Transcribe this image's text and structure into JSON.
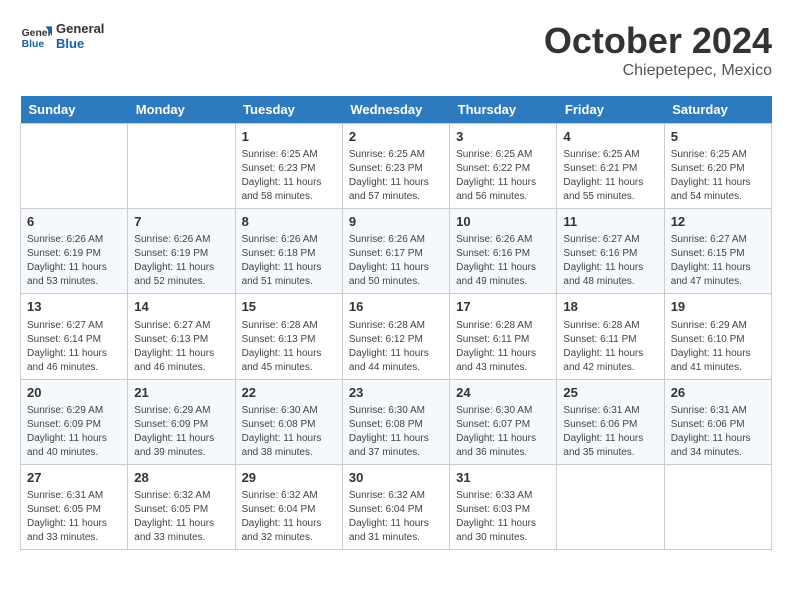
{
  "header": {
    "logo_general": "General",
    "logo_blue": "Blue",
    "month": "October 2024",
    "location": "Chiepetepec, Mexico"
  },
  "days_of_week": [
    "Sunday",
    "Monday",
    "Tuesday",
    "Wednesday",
    "Thursday",
    "Friday",
    "Saturday"
  ],
  "weeks": [
    [
      {
        "day": "",
        "info": ""
      },
      {
        "day": "",
        "info": ""
      },
      {
        "day": "1",
        "info": "Sunrise: 6:25 AM\nSunset: 6:23 PM\nDaylight: 11 hours and 58 minutes."
      },
      {
        "day": "2",
        "info": "Sunrise: 6:25 AM\nSunset: 6:23 PM\nDaylight: 11 hours and 57 minutes."
      },
      {
        "day": "3",
        "info": "Sunrise: 6:25 AM\nSunset: 6:22 PM\nDaylight: 11 hours and 56 minutes."
      },
      {
        "day": "4",
        "info": "Sunrise: 6:25 AM\nSunset: 6:21 PM\nDaylight: 11 hours and 55 minutes."
      },
      {
        "day": "5",
        "info": "Sunrise: 6:25 AM\nSunset: 6:20 PM\nDaylight: 11 hours and 54 minutes."
      }
    ],
    [
      {
        "day": "6",
        "info": "Sunrise: 6:26 AM\nSunset: 6:19 PM\nDaylight: 11 hours and 53 minutes."
      },
      {
        "day": "7",
        "info": "Sunrise: 6:26 AM\nSunset: 6:19 PM\nDaylight: 11 hours and 52 minutes."
      },
      {
        "day": "8",
        "info": "Sunrise: 6:26 AM\nSunset: 6:18 PM\nDaylight: 11 hours and 51 minutes."
      },
      {
        "day": "9",
        "info": "Sunrise: 6:26 AM\nSunset: 6:17 PM\nDaylight: 11 hours and 50 minutes."
      },
      {
        "day": "10",
        "info": "Sunrise: 6:26 AM\nSunset: 6:16 PM\nDaylight: 11 hours and 49 minutes."
      },
      {
        "day": "11",
        "info": "Sunrise: 6:27 AM\nSunset: 6:16 PM\nDaylight: 11 hours and 48 minutes."
      },
      {
        "day": "12",
        "info": "Sunrise: 6:27 AM\nSunset: 6:15 PM\nDaylight: 11 hours and 47 minutes."
      }
    ],
    [
      {
        "day": "13",
        "info": "Sunrise: 6:27 AM\nSunset: 6:14 PM\nDaylight: 11 hours and 46 minutes."
      },
      {
        "day": "14",
        "info": "Sunrise: 6:27 AM\nSunset: 6:13 PM\nDaylight: 11 hours and 46 minutes."
      },
      {
        "day": "15",
        "info": "Sunrise: 6:28 AM\nSunset: 6:13 PM\nDaylight: 11 hours and 45 minutes."
      },
      {
        "day": "16",
        "info": "Sunrise: 6:28 AM\nSunset: 6:12 PM\nDaylight: 11 hours and 44 minutes."
      },
      {
        "day": "17",
        "info": "Sunrise: 6:28 AM\nSunset: 6:11 PM\nDaylight: 11 hours and 43 minutes."
      },
      {
        "day": "18",
        "info": "Sunrise: 6:28 AM\nSunset: 6:11 PM\nDaylight: 11 hours and 42 minutes."
      },
      {
        "day": "19",
        "info": "Sunrise: 6:29 AM\nSunset: 6:10 PM\nDaylight: 11 hours and 41 minutes."
      }
    ],
    [
      {
        "day": "20",
        "info": "Sunrise: 6:29 AM\nSunset: 6:09 PM\nDaylight: 11 hours and 40 minutes."
      },
      {
        "day": "21",
        "info": "Sunrise: 6:29 AM\nSunset: 6:09 PM\nDaylight: 11 hours and 39 minutes."
      },
      {
        "day": "22",
        "info": "Sunrise: 6:30 AM\nSunset: 6:08 PM\nDaylight: 11 hours and 38 minutes."
      },
      {
        "day": "23",
        "info": "Sunrise: 6:30 AM\nSunset: 6:08 PM\nDaylight: 11 hours and 37 minutes."
      },
      {
        "day": "24",
        "info": "Sunrise: 6:30 AM\nSunset: 6:07 PM\nDaylight: 11 hours and 36 minutes."
      },
      {
        "day": "25",
        "info": "Sunrise: 6:31 AM\nSunset: 6:06 PM\nDaylight: 11 hours and 35 minutes."
      },
      {
        "day": "26",
        "info": "Sunrise: 6:31 AM\nSunset: 6:06 PM\nDaylight: 11 hours and 34 minutes."
      }
    ],
    [
      {
        "day": "27",
        "info": "Sunrise: 6:31 AM\nSunset: 6:05 PM\nDaylight: 11 hours and 33 minutes."
      },
      {
        "day": "28",
        "info": "Sunrise: 6:32 AM\nSunset: 6:05 PM\nDaylight: 11 hours and 33 minutes."
      },
      {
        "day": "29",
        "info": "Sunrise: 6:32 AM\nSunset: 6:04 PM\nDaylight: 11 hours and 32 minutes."
      },
      {
        "day": "30",
        "info": "Sunrise: 6:32 AM\nSunset: 6:04 PM\nDaylight: 11 hours and 31 minutes."
      },
      {
        "day": "31",
        "info": "Sunrise: 6:33 AM\nSunset: 6:03 PM\nDaylight: 11 hours and 30 minutes."
      },
      {
        "day": "",
        "info": ""
      },
      {
        "day": "",
        "info": ""
      }
    ]
  ]
}
